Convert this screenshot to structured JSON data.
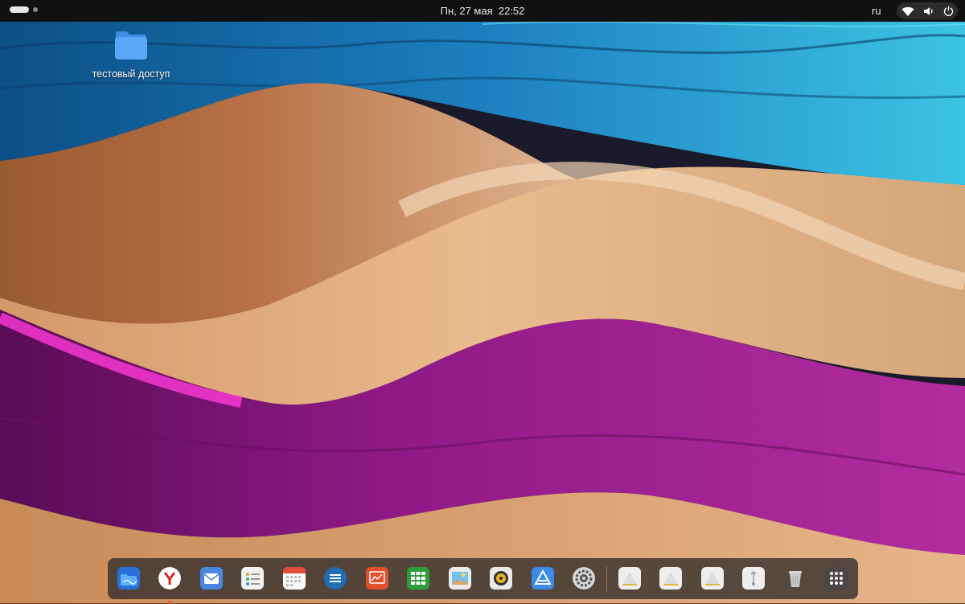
{
  "topbar": {
    "datetime": "Пн, 27 мая  22:52",
    "language": "ru"
  },
  "desktop": {
    "icons": [
      {
        "label": "тестовый доступ",
        "icon": "folder-icon"
      }
    ]
  },
  "dock": {
    "items": [
      {
        "name": "files",
        "icon": "files-icon"
      },
      {
        "name": "yandex-browser",
        "icon": "yandex-browser-icon",
        "running": true
      },
      {
        "name": "mail",
        "icon": "mail-icon"
      },
      {
        "name": "tasks",
        "icon": "checklist-icon"
      },
      {
        "name": "calendar",
        "icon": "calendar-icon"
      },
      {
        "name": "text-editor",
        "icon": "document-icon"
      },
      {
        "name": "presentation",
        "icon": "presentation-icon"
      },
      {
        "name": "spreadsheet",
        "icon": "spreadsheet-icon"
      },
      {
        "name": "image-viewer",
        "icon": "image-viewer-icon"
      },
      {
        "name": "music-player",
        "icon": "music-player-icon"
      },
      {
        "name": "app-store",
        "icon": "app-store-icon"
      },
      {
        "name": "settings",
        "icon": "settings-gear-icon"
      },
      {
        "name": "drive-1",
        "icon": "drive-icon"
      },
      {
        "name": "drive-2",
        "icon": "drive-icon"
      },
      {
        "name": "drive-3",
        "icon": "drive-icon"
      },
      {
        "name": "usb-drive",
        "icon": "usb-drive-icon"
      },
      {
        "name": "trash",
        "icon": "trash-icon"
      },
      {
        "name": "app-grid",
        "icon": "app-grid-icon"
      }
    ]
  },
  "colors": {
    "topbar_bg": "#111111",
    "accent_running": "#e9542a",
    "wallpaper_blue": "#1e7fb8",
    "wallpaper_wood": "#c98c5c",
    "wallpaper_magenta": "#a0248e"
  }
}
